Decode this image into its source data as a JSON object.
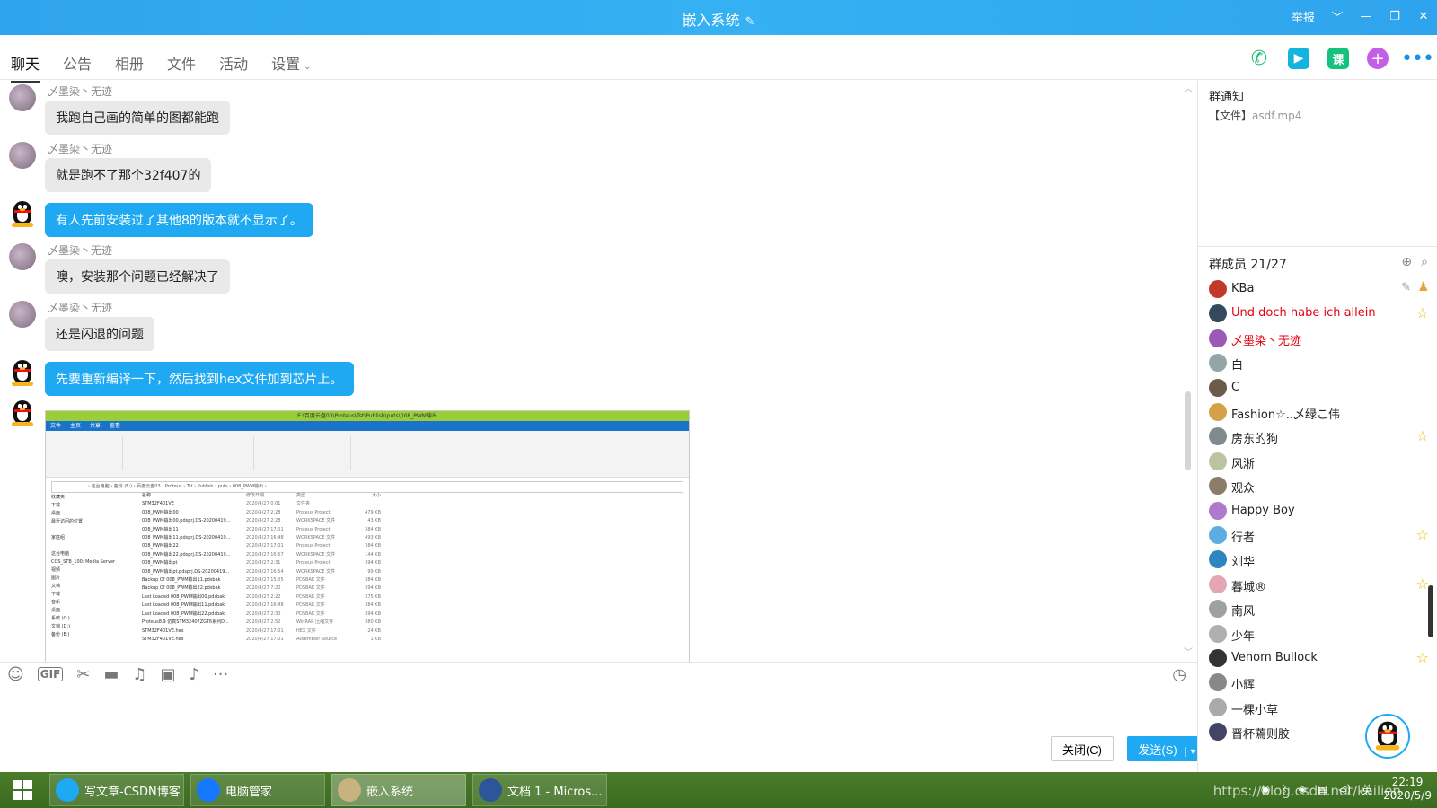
{
  "window": {
    "title": "嵌入系统",
    "edit_icon": "pencil-icon",
    "report_label": "举报"
  },
  "tabs": [
    {
      "label": "聊天",
      "active": true
    },
    {
      "label": "公告"
    },
    {
      "label": "相册"
    },
    {
      "label": "文件"
    },
    {
      "label": "活动"
    },
    {
      "label": "设置"
    }
  ],
  "toolbar_icons": [
    "phone-icon",
    "video-call-icon",
    "course-icon",
    "add-app-icon",
    "more-icon"
  ],
  "course_icon_text": "课",
  "messages": [
    {
      "sender": "乄墨染丶无迹",
      "text": "我跑自己画的简单的图都能跑",
      "self": false
    },
    {
      "sender": "乄墨染丶无迹",
      "text": "就是跑不了那个32f407的",
      "self": false
    },
    {
      "sender": "",
      "text": "有人先前安装过了其他8的版本就不显示了。",
      "self": true
    },
    {
      "sender": "乄墨染丶无迹",
      "text": "噢，安装那个问题已经解决了",
      "self": false
    },
    {
      "sender": "乄墨染丶无迹",
      "text": "还是闪退的问题",
      "self": false
    },
    {
      "sender": "",
      "text": "先要重新编译一下，然后找到hex文件加到芯片上。",
      "self": true
    }
  ],
  "screenshot": {
    "title": "E:\\百度云盘03\\Proteus\\Tst\\Publish\\puts\\008_PWM输出",
    "ribbon_tabs": [
      "文件",
      "主页",
      "共享",
      "查看"
    ],
    "address": "› 这台电脑 › 备份 (E:) › 百度云盘03 › Proteus › Tst › Publish › puts › 008_PWM输出 ›",
    "search_placeholder": "搜索\"008...\"",
    "nav": [
      "收藏夹",
      "下载",
      "桌面",
      "最近访问的位置",
      "",
      "家庭组",
      "",
      "这台电脑",
      "COS_STB_100: Media Server",
      "视频",
      "图片",
      "文档",
      "下载",
      "音乐",
      "桌面",
      "系统 (C:)",
      "文档 (D:)",
      "备份 (E:)"
    ],
    "columns": [
      "名称",
      "修改日期",
      "类型",
      "大小"
    ],
    "files": [
      [
        "STM32F401VE",
        "2020/4/27 0:01",
        "文件夹",
        ""
      ],
      [
        "008_PWM输出00",
        "2020/4/27 2:28",
        "Proteus Project",
        "479 KB"
      ],
      [
        "008_PWM输出00.pdsprj.DS-20200419...",
        "2020/4/27 2:28",
        "WORKSPACE 文件",
        "43 KB"
      ],
      [
        "008_PWM输出11",
        "2020/4/27 17:01",
        "Proteus Project",
        "384 KB"
      ],
      [
        "008_PWM输出11.pdsprj.DS-20200419...",
        "2020/4/27 16:48",
        "WORKSPACE 文件",
        "493 KB"
      ],
      [
        "008_PWM输出22",
        "2020/4/27 17:01",
        "Proteus Project",
        "384 KB"
      ],
      [
        "008_PWM输出22.pdsprj.DS-20200419...",
        "2020/4/27 16:57",
        "WORKSPACE 文件",
        "144 KB"
      ],
      [
        "008_PWM输出pt",
        "2020/4/27 2:31",
        "Proteus Project",
        "394 KB"
      ],
      [
        "008_PWM输出pt.pdsprj.DS-20200419...",
        "2020/4/27 16:54",
        "WORKSPACE 文件",
        "99 KB"
      ],
      [
        "Backup Of 008_PWM输出11.pdsbak",
        "2020/4/27 15:05",
        "PDSBAK 文件",
        "384 KB"
      ],
      [
        "Backup Of 008_PWM输出22.pdsbak",
        "2020/4/27 7:20",
        "PDSBAK 文件",
        "394 KB"
      ],
      [
        "Last Loaded 008_PWM输出00.pdsbak",
        "2020/4/27 2:22",
        "PDSBAK 文件",
        "375 KB"
      ],
      [
        "Last Loaded 008_PWM输出11.pdsbak",
        "2020/4/27 16:48",
        "PDSBAK 文件",
        "384 KB"
      ],
      [
        "Last Loaded 008_PWM输出22.pdsbak",
        "2020/4/27 2:30",
        "PDSBAK 文件",
        "394 KB"
      ],
      [
        "Proteus8.9 仿真STM32407ZGT6系列D...",
        "2020/4/27 2:52",
        "WinRAR 压缩文件",
        "380 KB"
      ],
      [
        "STM32F401VE.hex",
        "2020/4/27 17:01",
        "HEX 文件",
        "24 KB"
      ],
      [
        "STM32F401VE.hex",
        "2020/4/27 17:01",
        "Assembler Source",
        "1 KB"
      ]
    ]
  },
  "input_toolbar": [
    "emoji-icon",
    "gif-icon",
    "scissors-icon",
    "folder-icon",
    "music-icon",
    "image-icon",
    "bell-icon",
    "more-dots-icon"
  ],
  "gif_label": "GIF",
  "buttons": {
    "close": "关闭(C)",
    "send": "发送(S)"
  },
  "notice": {
    "heading": "群通知",
    "prefix": "【文件】",
    "file": "asdf.mp4"
  },
  "members": {
    "heading": "群成员 21/27",
    "list": [
      {
        "name": "KBa",
        "red": false,
        "star": false,
        "owner": true
      },
      {
        "name": "Und doch habe ich allein",
        "red": true,
        "star": true
      },
      {
        "name": "乄墨染丶无迹",
        "red": true,
        "star": false
      },
      {
        "name": "白",
        "red": false,
        "star": false
      },
      {
        "name": "C",
        "red": false,
        "star": false
      },
      {
        "name": "Fashion☆..乄绿こ伟",
        "red": false,
        "star": false
      },
      {
        "name": "房东的狗",
        "red": false,
        "star": true
      },
      {
        "name": "风淅",
        "red": false,
        "star": false
      },
      {
        "name": "观众",
        "red": false,
        "star": false
      },
      {
        "name": "Happy Boy",
        "red": false,
        "star": false
      },
      {
        "name": "行者",
        "red": false,
        "star": true
      },
      {
        "name": "刘华",
        "red": false,
        "star": false
      },
      {
        "name": "暮城®",
        "red": false,
        "star": true
      },
      {
        "name": "南风",
        "red": false,
        "star": false
      },
      {
        "name": "少年",
        "red": false,
        "star": false
      },
      {
        "name": "Venom Bullock",
        "red": false,
        "star": true
      },
      {
        "name": "小辉",
        "red": false,
        "star": false
      },
      {
        "name": "一棵小草",
        "red": false,
        "star": false
      },
      {
        "name": "晋杯蔫则胶",
        "red": false,
        "star": false
      }
    ]
  },
  "taskbar": {
    "items": [
      {
        "label": "写文章-CSDN博客",
        "icon": "browser-icon",
        "color": "#1ea9f2"
      },
      {
        "label": "电脑管家",
        "icon": "shield-icon",
        "color": "#1677ff"
      },
      {
        "label": "嵌入系统",
        "icon": "group-avatar-icon",
        "color": "#c8b27d",
        "active": true
      },
      {
        "label": "文档 1 - Micros...",
        "icon": "word-icon",
        "color": "#2b579a"
      }
    ],
    "tray_ime": "英",
    "time": "22:19",
    "date": "2020/5/9",
    "watermark": "https://blog.csdn.net/kailien"
  }
}
